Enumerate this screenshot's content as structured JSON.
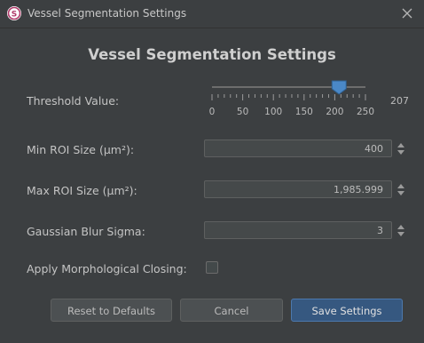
{
  "window": {
    "title": "Vessel Segmentation Settings",
    "app_icon": "app-logo-icon",
    "close_icon": "close-icon"
  },
  "heading": "Vessel Segmentation Settings",
  "threshold": {
    "label": "Threshold Value:",
    "value": 207,
    "value_text": "207",
    "min": 0,
    "max": 250,
    "major_ticks": [
      "0",
      "50",
      "100",
      "150",
      "200",
      "250"
    ],
    "minor_tick_step": 10
  },
  "min_roi": {
    "label": "Min ROI Size (μm²):",
    "value": "400"
  },
  "max_roi": {
    "label": "Max ROI Size (μm²):",
    "value": "1,985.999"
  },
  "gaussian": {
    "label": "Gaussian Blur Sigma:",
    "value": "3"
  },
  "morph": {
    "label": "Apply Morphological Closing:",
    "checked": false
  },
  "buttons": {
    "reset": "Reset to Defaults",
    "cancel": "Cancel",
    "save": "Save Settings"
  },
  "colors": {
    "background": "#3c3f41",
    "accent": "#4a88c7",
    "primary_button": "#365880"
  }
}
